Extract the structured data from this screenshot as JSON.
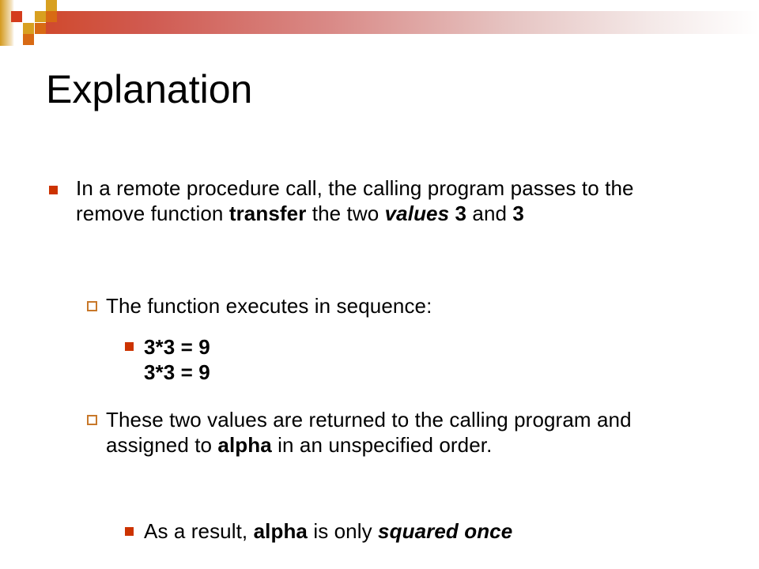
{
  "slide": {
    "title": "Explanation",
    "colors": {
      "accent": "#cc3300",
      "box_bullet": "#c8782a",
      "banner_start": "#d04a2e",
      "banner_end": "#ffffff",
      "square_gold": "#d8a020",
      "square_orange": "#d86a14",
      "square_red": "#d43c1c"
    },
    "bullets": [
      {
        "level": 1,
        "segments": [
          {
            "text": "In a remote procedure call, the calling program passes to the remove function ",
            "style": "normal"
          },
          {
            "text": "transfer",
            "style": "bold"
          },
          {
            "text": " the two ",
            "style": "normal"
          },
          {
            "text": "values",
            "style": "bold-italic"
          },
          {
            "text": " 3",
            "style": "bold"
          },
          {
            "text": " and ",
            "style": "normal"
          },
          {
            "text": "3",
            "style": "bold"
          }
        ]
      },
      {
        "level": 2,
        "segments": [
          {
            "text": "The function executes in sequence:",
            "style": "normal"
          }
        ]
      },
      {
        "level": 3,
        "lines": [
          "3*3 = 9",
          "3*3 = 9"
        ]
      },
      {
        "level": 2,
        "segments": [
          {
            "text": "These two values are returned to the calling program and assigned to ",
            "style": "normal"
          },
          {
            "text": "alpha",
            "style": "bold"
          },
          {
            "text": " in an unspecified order.",
            "style": "normal"
          }
        ]
      },
      {
        "level": 3,
        "segments": [
          {
            "text": "As a result, ",
            "style": "normal"
          },
          {
            "text": "alpha",
            "style": "bold"
          },
          {
            "text": " is only ",
            "style": "normal"
          },
          {
            "text": "squared once",
            "style": "bold-italic"
          }
        ]
      }
    ]
  }
}
